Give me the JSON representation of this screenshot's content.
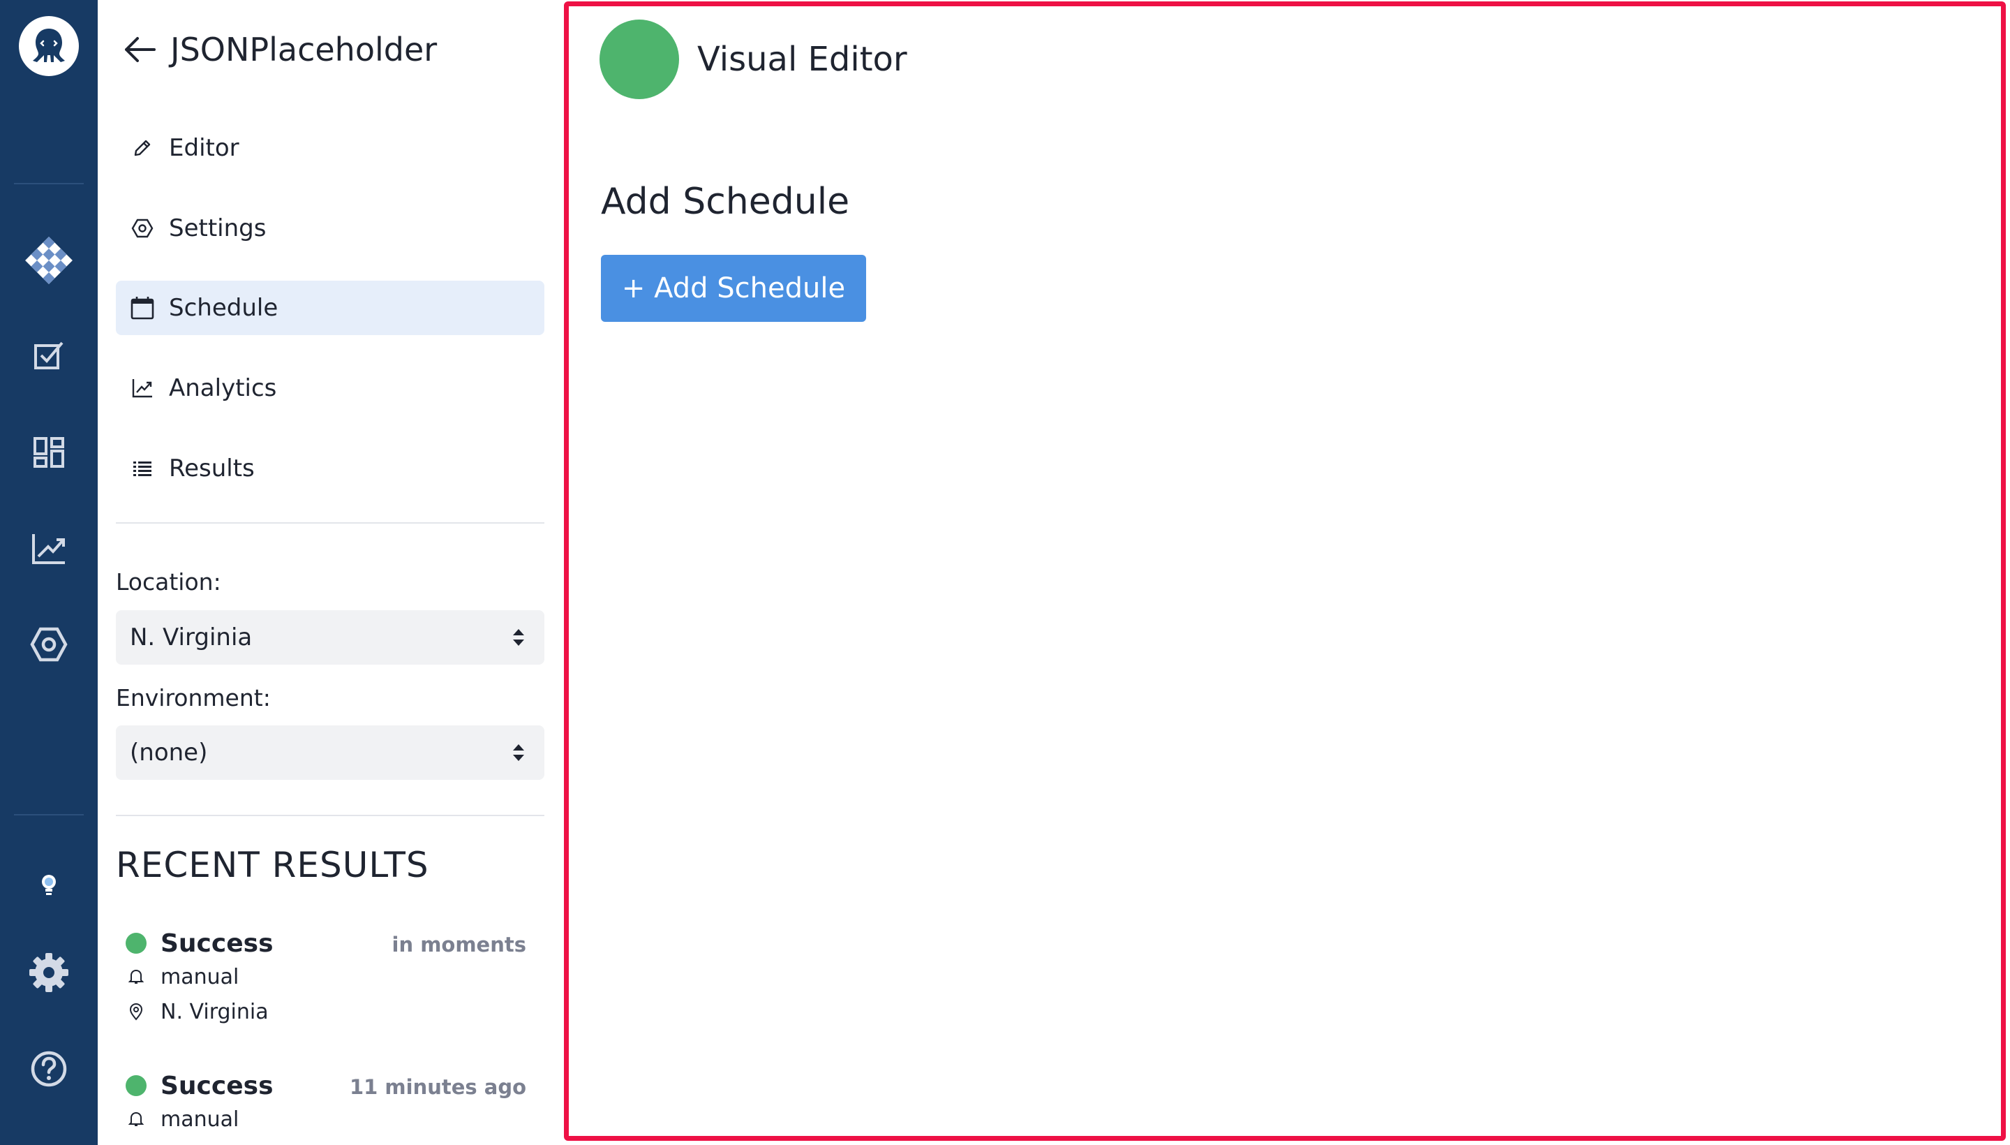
{
  "project": {
    "title": "JSONPlaceholder"
  },
  "nav": {
    "items": [
      {
        "label": "Editor",
        "icon": "pencil-icon"
      },
      {
        "label": "Settings",
        "icon": "hexagon-gear-icon"
      },
      {
        "label": "Schedule",
        "icon": "calendar-icon",
        "active": true
      },
      {
        "label": "Analytics",
        "icon": "chart-line-icon"
      },
      {
        "label": "Results",
        "icon": "list-icon"
      }
    ]
  },
  "location": {
    "label": "Location:",
    "value": "N. Virginia"
  },
  "environment": {
    "label": "Environment:",
    "value": "(none)"
  },
  "recent": {
    "title": "RECENT RESULTS",
    "items": [
      {
        "status": "Success",
        "time": "in moments",
        "trigger": "manual",
        "location": "N. Virginia"
      },
      {
        "status": "Success",
        "time": "11 minutes ago",
        "trigger": "manual"
      }
    ]
  },
  "main": {
    "editor_title": "Visual Editor",
    "section_title": "Add Schedule",
    "add_button": "+ Add Schedule"
  },
  "colors": {
    "rail": "#173a64",
    "accent": "#4a90e2",
    "success": "#4eb46d",
    "focus_border": "#ee1145",
    "active_nav": "#e6eefa"
  }
}
